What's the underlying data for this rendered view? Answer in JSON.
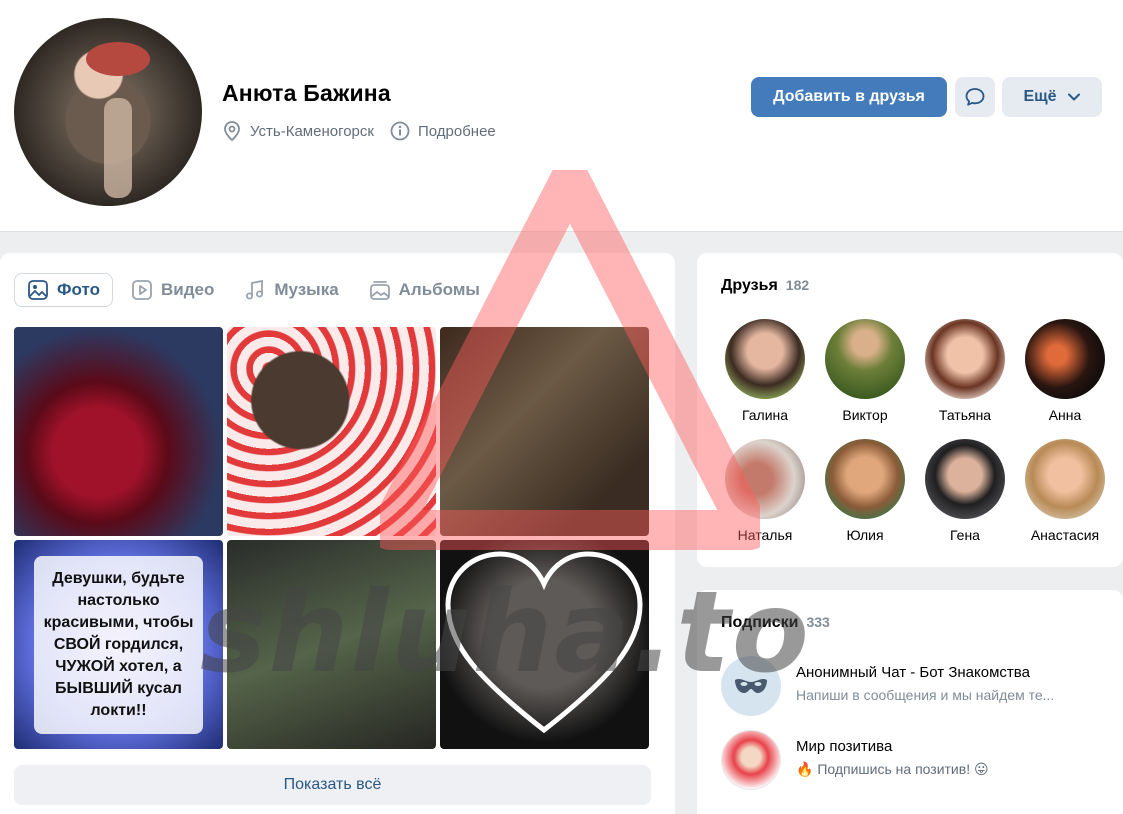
{
  "profile": {
    "name": "Анюта Бажина",
    "city": "Усть-Каменогорск",
    "details_label": "Подробнее"
  },
  "actions": {
    "add_friend": "Добавить в друзья",
    "more": "Ещё"
  },
  "media": {
    "tabs": [
      {
        "label": "Фото",
        "icon": "photo-icon",
        "active": true
      },
      {
        "label": "Видео",
        "icon": "video-icon",
        "active": false
      },
      {
        "label": "Музыка",
        "icon": "music-icon",
        "active": false
      },
      {
        "label": "Альбомы",
        "icon": "albums-icon",
        "active": false
      }
    ],
    "photo_quote": "Девушки, будьте настолько красивыми, чтобы СВОЙ гордился, ЧУЖОЙ хотел, а БЫВШИЙ кусал локти!!",
    "show_all": "Показать всё"
  },
  "friends": {
    "title": "Друзья",
    "count": "182",
    "items": [
      {
        "name": "Галина"
      },
      {
        "name": "Виктор"
      },
      {
        "name": "Татьяна"
      },
      {
        "name": "Анна"
      },
      {
        "name": "Наталья"
      },
      {
        "name": "Юлия"
      },
      {
        "name": "Гена"
      },
      {
        "name": "Анастасия"
      }
    ]
  },
  "subscriptions": {
    "title": "Подписки",
    "count": "333",
    "items": [
      {
        "title": "Анонимный Чат - Бот Знакомства",
        "desc": "Напиши в сообщения и мы найдем те..."
      },
      {
        "title": "Мир позитива",
        "desc": "🔥 Подпишись на позитив! 😛"
      }
    ]
  },
  "watermark": "shluha.to",
  "colors": {
    "primary_button": "#447bba",
    "link": "#2a5885",
    "secondary_text": "#818c99",
    "background": "#edeef0"
  }
}
